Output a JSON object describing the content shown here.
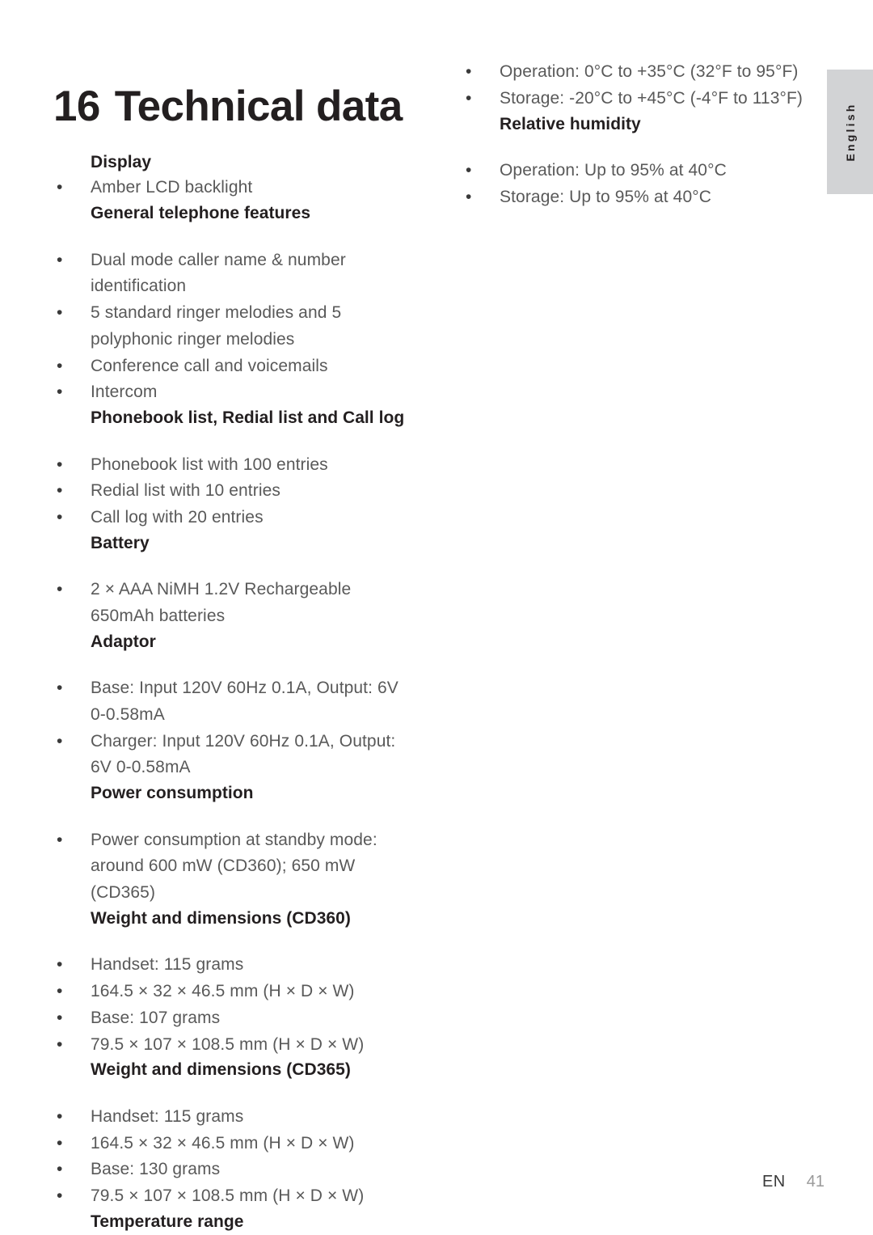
{
  "document": {
    "title_number": "16",
    "title_text": "Technical data",
    "language_tab": "English",
    "footer_locale": "EN",
    "footer_page": "41",
    "colors": {
      "heading": "#231f20",
      "body": "#595959",
      "tab_background": "#d2d3d5",
      "page_background": "#ffffff"
    }
  },
  "left_column": {
    "blocks": [
      {
        "type": "heading",
        "text": "Display"
      },
      {
        "type": "bullet",
        "lines": [
          "Amber LCD backlight"
        ]
      },
      {
        "type": "heading",
        "text": "General telephone features",
        "spacer_after": true
      },
      {
        "type": "bullet",
        "lines": [
          "Dual mode caller name & number",
          "identification"
        ]
      },
      {
        "type": "bullet",
        "lines": [
          "5 standard ringer melodies and 5",
          "polyphonic ringer melodies"
        ]
      },
      {
        "type": "bullet",
        "lines": [
          "Conference call and voicemails"
        ]
      },
      {
        "type": "bullet",
        "lines": [
          "Intercom"
        ]
      },
      {
        "type": "heading",
        "text": "Phonebook list, Redial list and Call log",
        "spacer_after": true
      },
      {
        "type": "bullet",
        "lines": [
          "Phonebook list with 100 entries"
        ]
      },
      {
        "type": "bullet",
        "lines": [
          "Redial list with 10 entries"
        ]
      },
      {
        "type": "bullet",
        "lines": [
          "Call log with 20 entries"
        ]
      },
      {
        "type": "heading",
        "text": "Battery",
        "spacer_after": true
      },
      {
        "type": "bullet",
        "lines": [
          "2 × AAA NiMH 1.2V Rechargeable",
          "650mAh batteries"
        ]
      },
      {
        "type": "heading",
        "text": "Adaptor",
        "spacer_after": true
      },
      {
        "type": "bullet",
        "lines": [
          "Base: Input 120V 60Hz 0.1A, Output: 6V",
          "0-0.58mA"
        ]
      },
      {
        "type": "bullet",
        "lines": [
          "Charger: Input 120V 60Hz 0.1A, Output:",
          "6V 0-0.58mA"
        ]
      },
      {
        "type": "heading",
        "text": "Power consumption",
        "spacer_after": true
      },
      {
        "type": "bullet",
        "lines": [
          "Power consumption at standby mode:",
          "around 600 mW (CD360); 650 mW",
          "(CD365)"
        ]
      },
      {
        "type": "heading",
        "text": "Weight and dimensions (CD360)",
        "spacer_after": true
      },
      {
        "type": "bullet",
        "lines": [
          "Handset: 115 grams"
        ]
      },
      {
        "type": "bullet",
        "lines": [
          "164.5 × 32 × 46.5 mm (H × D × W)"
        ]
      },
      {
        "type": "bullet",
        "lines": [
          "Base: 107 grams"
        ]
      },
      {
        "type": "bullet",
        "lines": [
          "79.5 × 107 × 108.5 mm (H × D × W)"
        ]
      },
      {
        "type": "heading",
        "text": "Weight and dimensions (CD365)",
        "spacer_after": true
      },
      {
        "type": "bullet",
        "lines": [
          "Handset: 115 grams"
        ]
      },
      {
        "type": "bullet",
        "lines": [
          "164.5 × 32 × 46.5 mm (H × D × W)"
        ]
      },
      {
        "type": "bullet",
        "lines": [
          "Base: 130 grams"
        ]
      },
      {
        "type": "bullet",
        "lines": [
          "79.5 × 107 × 108.5 mm (H × D × W)"
        ]
      },
      {
        "type": "heading",
        "text": "Temperature range"
      }
    ]
  },
  "right_column": {
    "blocks": [
      {
        "type": "bullet",
        "lines": [
          "Operation: 0°C to +35°C (32°F to 95°F)"
        ]
      },
      {
        "type": "bullet",
        "lines": [
          "Storage: -20°C to +45°C (-4°F to 113°F)"
        ]
      },
      {
        "type": "heading",
        "text": "Relative humidity",
        "spacer_after": true
      },
      {
        "type": "bullet",
        "lines": [
          "Operation: Up to 95% at 40°C"
        ]
      },
      {
        "type": "bullet",
        "lines": [
          "Storage: Up to 95% at 40°C"
        ]
      }
    ]
  },
  "bullet_glyph": "•"
}
